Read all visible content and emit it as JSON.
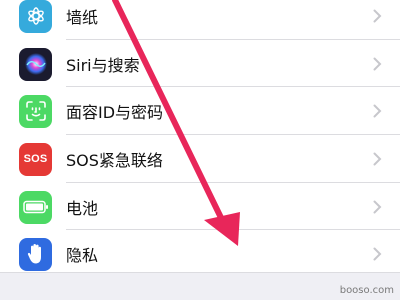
{
  "settings": {
    "rows": [
      {
        "label": "墙纸",
        "icon": "wallpaper-icon",
        "icon_color": "#35aadc"
      },
      {
        "label": "Siri与搜索",
        "icon": "siri-icon",
        "icon_color": "#1b1b2f"
      },
      {
        "label": "面容ID与密码",
        "icon": "face-id-icon",
        "icon_color": "#4cd964"
      },
      {
        "label": "SOS紧急联络",
        "icon": "sos-icon",
        "icon_color": "#e53935",
        "icon_text": "SOS"
      },
      {
        "label": "电池",
        "icon": "battery-icon",
        "icon_color": "#4cd964"
      },
      {
        "label": "隐私",
        "icon": "privacy-hand-icon",
        "icon_color": "#2f6be0"
      }
    ]
  },
  "annotation": {
    "arrow_color": "#e8265a"
  },
  "watermark": "booso.com"
}
